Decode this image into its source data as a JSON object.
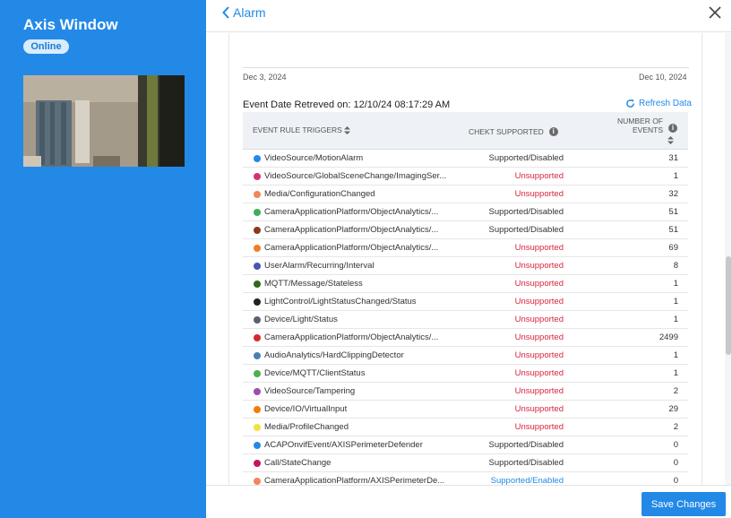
{
  "sidebar": {
    "title": "Axis Window",
    "status": "Online"
  },
  "header": {
    "back_label": "Alarm"
  },
  "range": {
    "start": "Dec 3, 2024",
    "end": "Dec 10, 2024"
  },
  "retrieved_label": "Event Date Retreved on: 12/10/24 08:17:29 AM",
  "refresh_label": "Refresh Data",
  "table": {
    "headers": {
      "trigger": "EVENT RULE TRIGGERS",
      "chekt": "CHEKT SUPPORTED",
      "num_line1": "NUMBER OF",
      "num_line2": "EVENTS"
    },
    "rows": [
      {
        "color": "#2389e6",
        "name": "VideoSource/MotionAlarm",
        "support": "Supported/Disabled",
        "status": "supported",
        "count": "31"
      },
      {
        "color": "#d6336c",
        "name": "VideoSource/GlobalSceneChange/ImagingSer...",
        "support": "Unsupported",
        "status": "unsupported",
        "count": "1"
      },
      {
        "color": "#f0875a",
        "name": "Media/ConfigurationChanged",
        "support": "Unsupported",
        "status": "unsupported",
        "count": "32"
      },
      {
        "color": "#3fae57",
        "name": "CameraApplicationPlatform/ObjectAnalytics/...",
        "support": "Supported/Disabled",
        "status": "supported",
        "count": "51"
      },
      {
        "color": "#8b3a1e",
        "name": "CameraApplicationPlatform/ObjectAnalytics/...",
        "support": "Supported/Disabled",
        "status": "supported",
        "count": "51"
      },
      {
        "color": "#f07d2a",
        "name": "CameraApplicationPlatform/ObjectAnalytics/...",
        "support": "Unsupported",
        "status": "unsupported",
        "count": "69"
      },
      {
        "color": "#4a55b0",
        "name": "UserAlarm/Recurring/Interval",
        "support": "Unsupported",
        "status": "unsupported",
        "count": "8"
      },
      {
        "color": "#2e6a1c",
        "name": "MQTT/Message/Stateless",
        "support": "Unsupported",
        "status": "unsupported",
        "count": "1"
      },
      {
        "color": "#222222",
        "name": "LightControl/LightStatusChanged/Status",
        "support": "Unsupported",
        "status": "unsupported",
        "count": "1"
      },
      {
        "color": "#5a6170",
        "name": "Device/Light/Status",
        "support": "Unsupported",
        "status": "unsupported",
        "count": "1"
      },
      {
        "color": "#d62828",
        "name": "CameraApplicationPlatform/ObjectAnalytics/...",
        "support": "Unsupported",
        "status": "unsupported",
        "count": "2499"
      },
      {
        "color": "#4a7fb5",
        "name": "AudioAnalytics/HardClippingDetector",
        "support": "Unsupported",
        "status": "unsupported",
        "count": "1"
      },
      {
        "color": "#4caf50",
        "name": "Device/MQTT/ClientStatus",
        "support": "Unsupported",
        "status": "unsupported",
        "count": "1"
      },
      {
        "color": "#9b4fb0",
        "name": "VideoSource/Tampering",
        "support": "Unsupported",
        "status": "unsupported",
        "count": "2"
      },
      {
        "color": "#f57c00",
        "name": "Device/IO/VirtualInput",
        "support": "Unsupported",
        "status": "unsupported",
        "count": "29"
      },
      {
        "color": "#f2e33c",
        "name": "Media/ProfileChanged",
        "support": "Unsupported",
        "status": "unsupported",
        "count": "2"
      },
      {
        "color": "#2389e6",
        "name": "ACAPOnvifEvent/AXISPerimeterDefender",
        "support": "Supported/Disabled",
        "status": "supported",
        "count": "0"
      },
      {
        "color": "#c2185b",
        "name": "Call/StateChange",
        "support": "Supported/Disabled",
        "status": "supported",
        "count": "0"
      },
      {
        "color": "#f0875a",
        "name": "CameraApplicationPlatform/AXISPerimeterDe...",
        "support": "Supported/Enabled",
        "status": "enabled",
        "count": "0"
      }
    ]
  },
  "footer": {
    "save_label": "Save Changes"
  },
  "colors": {
    "accent": "#2389e6",
    "unsupported": "#d6263d"
  }
}
